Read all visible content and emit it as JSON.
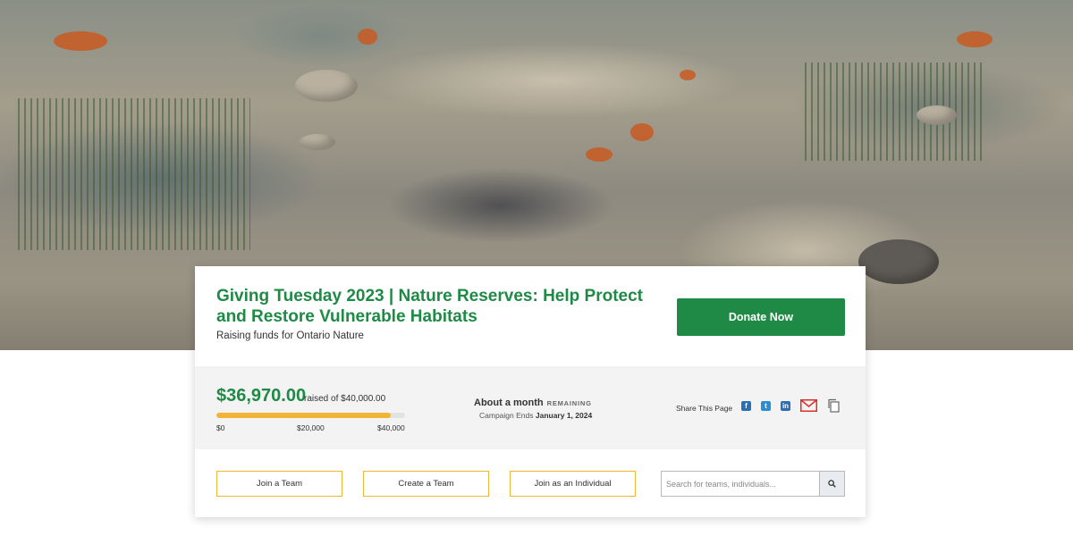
{
  "campaign": {
    "title": "Giving Tuesday 2023 | Nature Reserves: Help Protect and Restore Vulnerable Habitats",
    "subtitle": "Raising funds for Ontario Nature",
    "donate_label": "Donate Now"
  },
  "progress": {
    "raised": "$36,970.00",
    "raised_of": "raised of $40,000.00",
    "fraction": 0.924,
    "ticks": [
      "$0",
      "$20,000",
      "$40,000"
    ]
  },
  "timing": {
    "remaining": "About a month",
    "remaining_suffix": "REMAINING",
    "ends_label": "Campaign Ends",
    "ends_date": "January 1, 2024"
  },
  "share": {
    "label": "Share This Page",
    "icons": [
      "facebook-icon",
      "twitter-icon",
      "linkedin-icon",
      "email-icon",
      "copy-link-icon"
    ]
  },
  "actions": {
    "join_team": "Join a Team",
    "create_team": "Create a Team",
    "join_individual": "Join as an Individual"
  },
  "search": {
    "placeholder": "Search for teams, individuals...",
    "value": ""
  },
  "colors": {
    "brand_green": "#1f8a45",
    "accent_gold": "#f1b434"
  }
}
